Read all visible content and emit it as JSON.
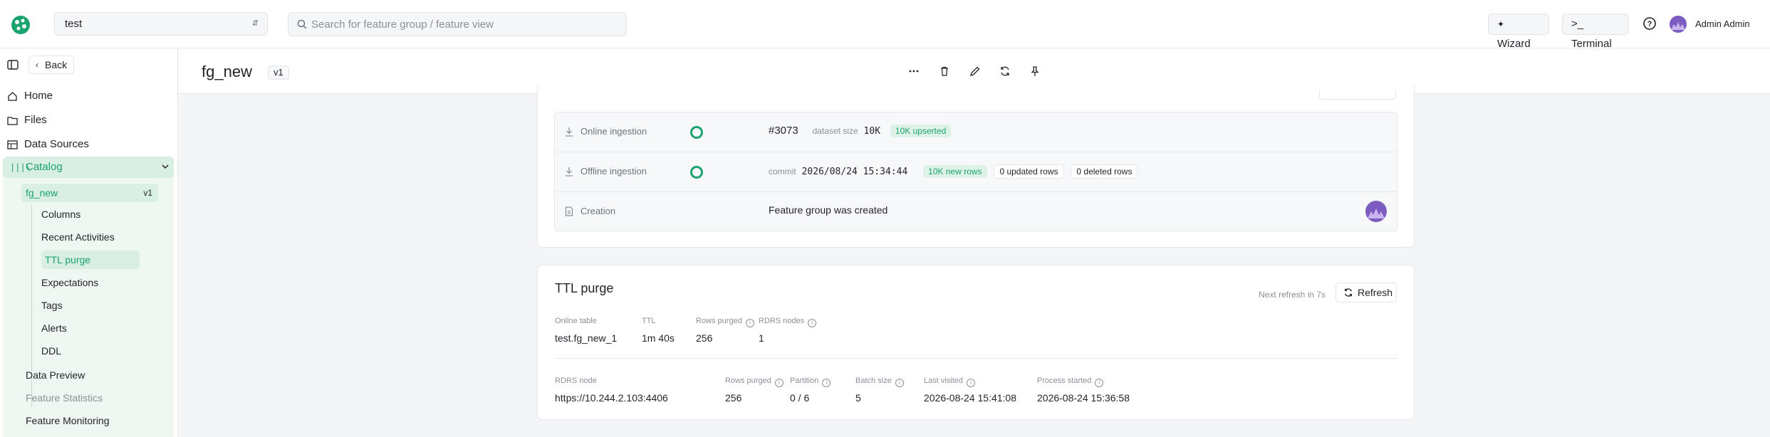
{
  "topbar": {
    "project": "test",
    "search_placeholder": "Search for feature group / feature view",
    "wizard_label": "Wizard",
    "terminal_label": ">_ Terminal",
    "user_name": "Admin Admin"
  },
  "sidebar": {
    "back_label": "Back",
    "items": [
      {
        "label": "Home",
        "icon": "home-icon"
      },
      {
        "label": "Files",
        "icon": "folder-icon"
      },
      {
        "label": "Data Sources",
        "icon": "table-icon"
      }
    ],
    "catalog_label": "Catalog",
    "feature_group": {
      "name": "fg_new",
      "version": "v1"
    },
    "sub_items": [
      "Columns",
      "Recent Activities",
      "TTL purge",
      "Expectations",
      "Tags",
      "Alerts",
      "DDL"
    ],
    "active_sub_item": "TTL purge",
    "section_items": [
      "Data Preview",
      "Feature Statistics",
      "Feature Monitoring"
    ]
  },
  "header": {
    "title": "fg_new",
    "version": "v1"
  },
  "activities": {
    "rows": [
      {
        "name": "Online ingestion",
        "id": "#3073",
        "dataset_size_label": "dataset size",
        "dataset_size": "10K",
        "badge": "10K upserted"
      },
      {
        "name": "Offline ingestion",
        "commit_label": "commit",
        "commit_time": "2026/08/24 15:34:44",
        "badge_new": "10K new rows",
        "badge_updated": "0 updated rows",
        "badge_deleted": "0 deleted rows"
      },
      {
        "name": "Creation",
        "message": "Feature group was created"
      }
    ]
  },
  "ttl": {
    "title": "TTL purge",
    "next_refresh": "Next refresh in 7s",
    "refresh_label": "Refresh",
    "summary": {
      "online_table_label": "Online table",
      "online_table": "test.fg_new_1",
      "ttl_label": "TTL",
      "ttl": "1m 40s",
      "rows_purged_label": "Rows purged",
      "rows_purged": "256",
      "rdrs_nodes_label": "RDRS nodes",
      "rdrs_nodes": "1"
    },
    "node": {
      "rdrs_node_label": "RDRS node",
      "rdrs_node": "https://10.244.2.103:4406",
      "rows_purged_label": "Rows purged",
      "rows_purged": "256",
      "partition_label": "Partition",
      "partition": "0 / 6",
      "batch_size_label": "Batch size",
      "batch_size": "5",
      "last_visited_label": "Last visited",
      "last_visited": "2026-08-24 15:41:08",
      "process_started_label": "Process started",
      "process_started": "2026-08-24 15:36:58"
    }
  },
  "colors": {
    "accent": "#1aa36f",
    "accent_bg": "#d9efe3",
    "avatar": "#7c5cbf"
  }
}
